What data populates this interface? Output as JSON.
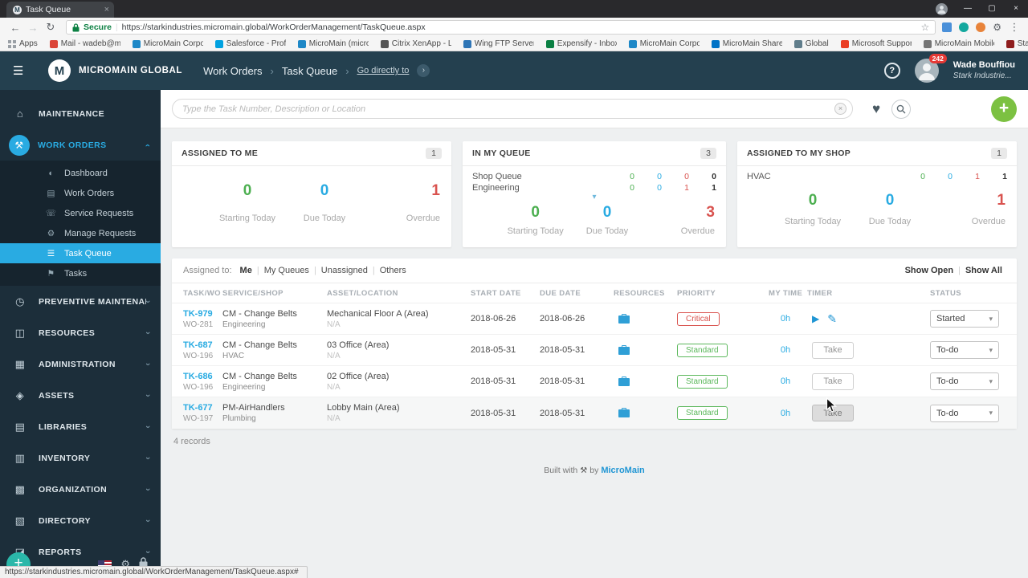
{
  "browser": {
    "tab_title": "Task Queue",
    "tab_fav": "M",
    "secure_label": "Secure",
    "url": "https://starkindustries.micromain.global/WorkOrderManagement/TaskQueue.aspx",
    "status_url": "https://starkindustries.micromain.global/WorkOrderManagement/TaskQueue.aspx#",
    "apps_label": "Apps",
    "bookmarks": [
      {
        "label": "Mail - wadeb@micr...",
        "color": "#db4437"
      },
      {
        "label": "MicroMain Corporat...",
        "color": "#1e88c7"
      },
      {
        "label": "Salesforce - Professi...",
        "color": "#00a1e0"
      },
      {
        "label": "MicroMain (microm...",
        "color": "#1e88c7"
      },
      {
        "label": "Citrix XenApp - Log...",
        "color": "#555555"
      },
      {
        "label": "Wing FTP Server",
        "color": "#2e75b6"
      },
      {
        "label": "Expensify - Inbox",
        "color": "#0b8043"
      },
      {
        "label": "MicroMain Corporat...",
        "color": "#1e88c7"
      },
      {
        "label": "MicroMain SharePoi...",
        "color": "#0072c6"
      },
      {
        "label": "Global",
        "color": "#607d8b"
      },
      {
        "label": "Microsoft Support",
        "color": "#ea3e23"
      },
      {
        "label": "MicroMain Mobile",
        "color": "#757575"
      },
      {
        "label": "StarkIndustries",
        "color": "#8e1d1d"
      }
    ]
  },
  "header": {
    "logo_letter": "M",
    "brand": "MICROMAIN GLOBAL",
    "breadcrumb_section": "Work Orders",
    "breadcrumb_page": "Task Queue",
    "breadcrumb_link": "Go directly to",
    "help": "?",
    "badge_count": "242",
    "user_name": "Wade Bouffiou",
    "user_org": "Stark Industrie..."
  },
  "sidebar": {
    "items": [
      {
        "label": "MAINTENANCE",
        "glyph": "⌂"
      },
      {
        "label": "WORK ORDERS",
        "glyph": "⚒"
      },
      {
        "label": "PREVENTIVE MAINTENANCE",
        "glyph": "◷"
      },
      {
        "label": "RESOURCES",
        "glyph": "◫"
      },
      {
        "label": "ADMINISTRATION",
        "glyph": "▦"
      },
      {
        "label": "ASSETS",
        "glyph": "◈"
      },
      {
        "label": "LIBRARIES",
        "glyph": "▤"
      },
      {
        "label": "INVENTORY",
        "glyph": "▥"
      },
      {
        "label": "ORGANIZATION",
        "glyph": "▩"
      },
      {
        "label": "DIRECTORY",
        "glyph": "▧"
      },
      {
        "label": "REPORTS",
        "glyph": "◪"
      }
    ],
    "work_orders_sub": [
      {
        "label": "Dashboard",
        "glyph": "◐"
      },
      {
        "label": "Work Orders",
        "glyph": "▤"
      },
      {
        "label": "Service Requests",
        "glyph": "☏"
      },
      {
        "label": "Manage Requests",
        "glyph": "⚙"
      },
      {
        "label": "Task Queue",
        "glyph": "☰"
      },
      {
        "label": "Tasks",
        "glyph": "⚑"
      }
    ]
  },
  "search": {
    "placeholder": "Type the Task Number, Description or Location"
  },
  "cards": {
    "assigned_to_me": {
      "title": "ASSIGNED TO ME",
      "badge": "1",
      "starting": "0",
      "due": "0",
      "overdue": "1",
      "starting_label": "Starting Today",
      "due_label": "Due Today",
      "overdue_label": "Overdue"
    },
    "in_my_queue": {
      "title": "IN MY QUEUE",
      "badge": "3",
      "rows": [
        {
          "name": "Shop Queue",
          "v1": "0",
          "v2": "0",
          "v3": "0",
          "v4": "0"
        },
        {
          "name": "Engineering",
          "v1": "0",
          "v2": "0",
          "v3": "1",
          "v4": "1"
        }
      ],
      "starting": "0",
      "due": "0",
      "overdue": "3",
      "starting_label": "Starting Today",
      "due_label": "Due Today",
      "overdue_label": "Overdue"
    },
    "assigned_to_my_shop": {
      "title": "ASSIGNED TO MY SHOP",
      "badge": "1",
      "rows": [
        {
          "name": "HVAC",
          "v1": "0",
          "v2": "0",
          "v3": "1",
          "v4": "1"
        }
      ],
      "starting": "0",
      "due": "0",
      "overdue": "1",
      "starting_label": "Starting Today",
      "due_label": "Due Today",
      "overdue_label": "Overdue"
    }
  },
  "filters": {
    "label": "Assigned to:",
    "me": "Me",
    "my_queues": "My Queues",
    "unassigned": "Unassigned",
    "others": "Others",
    "show_open": "Show Open",
    "show_all": "Show All"
  },
  "table": {
    "headers": [
      "TASK/WO",
      "SERVICE/SHOP",
      "ASSET/LOCATION",
      "START DATE",
      "DUE DATE",
      "RESOURCES",
      "PRIORITY",
      "MY TIME",
      "TIMER",
      "STATUS"
    ],
    "rows": [
      {
        "task": "TK-979",
        "wo": "WO-281",
        "service": "CM - Change Belts",
        "shop": "Engineering",
        "asset": "Mechanical Floor A (Area)",
        "location": "N/A",
        "start": "2018-06-26",
        "due": "2018-06-26",
        "priority": "Critical",
        "time": "0h",
        "status": "Started"
      },
      {
        "task": "TK-687",
        "wo": "WO-196",
        "service": "CM - Change Belts",
        "shop": "HVAC",
        "asset": "03 Office (Area)",
        "location": "N/A",
        "start": "2018-05-31",
        "due": "2018-05-31",
        "priority": "Standard",
        "time": "0h",
        "take": "Take",
        "status": "To-do"
      },
      {
        "task": "TK-686",
        "wo": "WO-196",
        "service": "CM - Change Belts",
        "shop": "Engineering",
        "asset": "02 Office (Area)",
        "location": "N/A",
        "start": "2018-05-31",
        "due": "2018-05-31",
        "priority": "Standard",
        "time": "0h",
        "take": "Take",
        "status": "To-do"
      },
      {
        "task": "TK-677",
        "wo": "WO-197",
        "service": "PM-AirHandlers",
        "shop": "Plumbing",
        "asset": "Lobby Main (Area)",
        "location": "N/A",
        "start": "2018-05-31",
        "due": "2018-05-31",
        "priority": "Standard",
        "time": "0h",
        "take": "Take",
        "status": "To-do"
      }
    ],
    "records": "4 records"
  },
  "footer": {
    "built_with": "Built with",
    "by": "by",
    "brand": "MicroMain"
  },
  "colors": {
    "accent_blue": "#29abe2",
    "accent_green": "#4caf50",
    "accent_red": "#d9534f",
    "brand_green": "#7cc142"
  }
}
